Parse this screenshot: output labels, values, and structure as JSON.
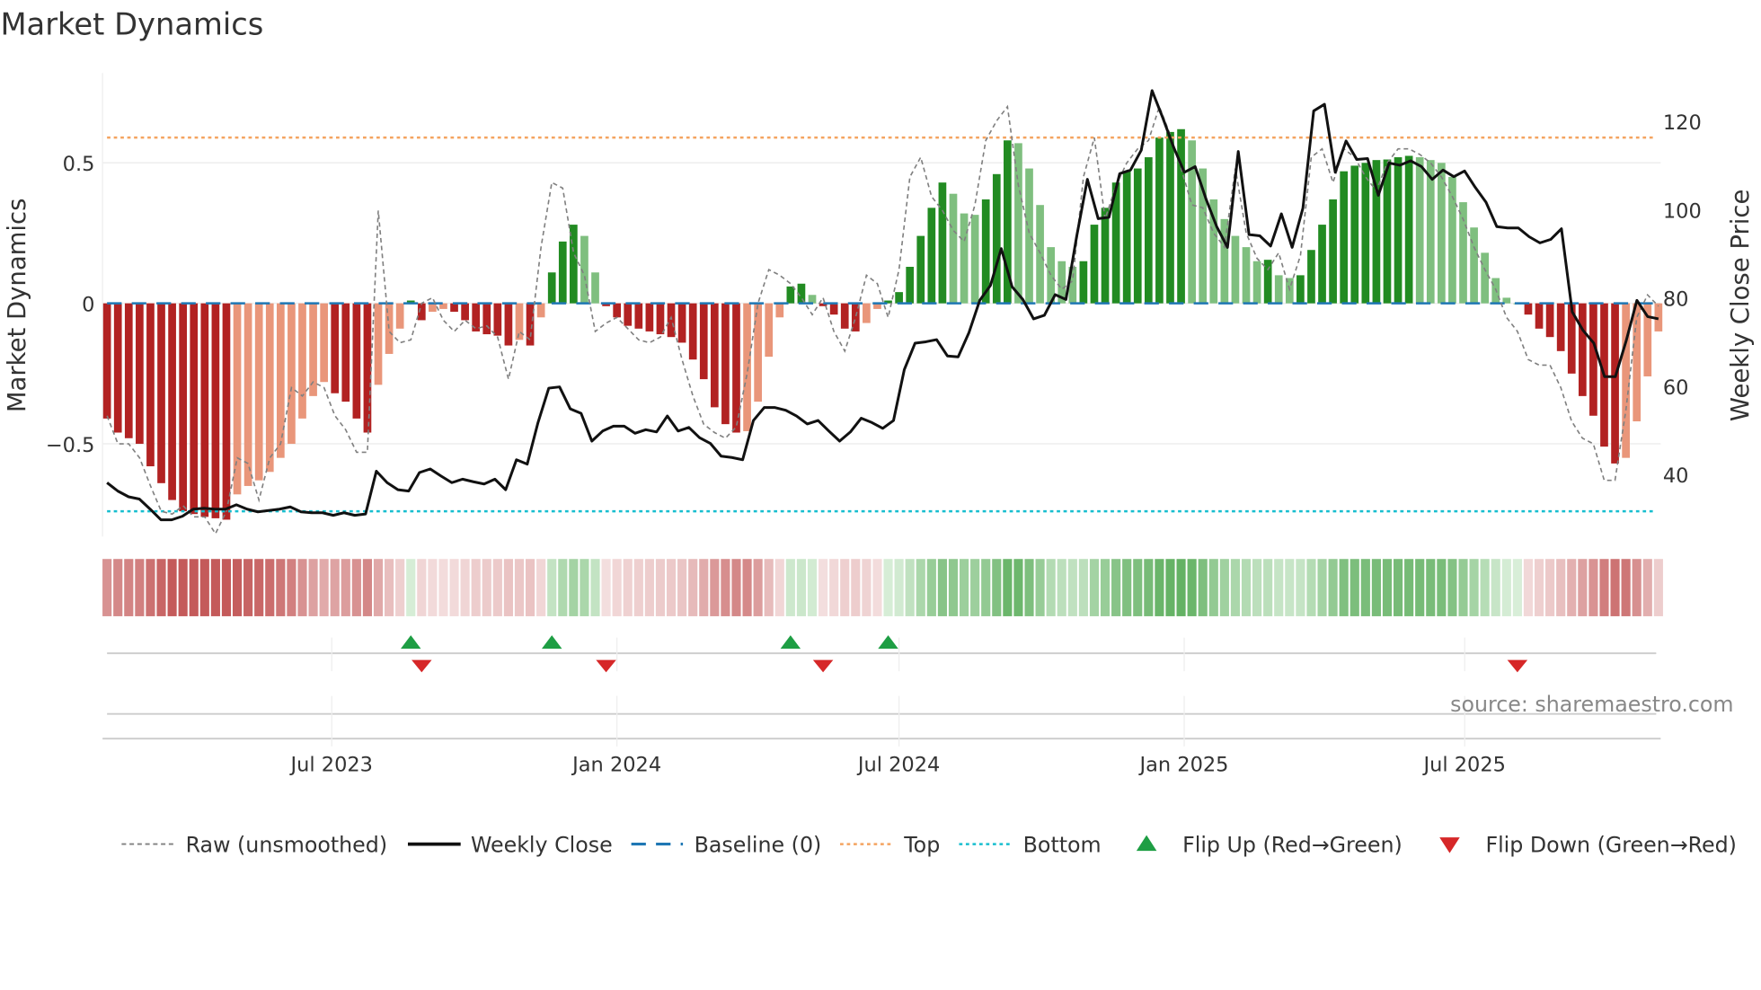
{
  "title": "Market Dynamics",
  "source": "source: sharemaestro.com",
  "colors": {
    "bar_neg_falling": "#b22222",
    "bar_neg_rising": "#e9967a",
    "bar_pos_rising": "#228b22",
    "bar_pos_falling": "#7fbf7f",
    "raw": "#808080",
    "close": "#111111",
    "baseline": "#1f77b4",
    "top": "#f4a460",
    "bottom": "#17becf",
    "flip_up": "#1e9e44",
    "flip_down": "#d62728"
  },
  "chart_data": {
    "type": "bar",
    "title": "Market Dynamics",
    "ylabel": "Market Dynamics",
    "ylabel_right": "Weekly Close Price",
    "start_date": "2023-02-06",
    "frequency": "weekly",
    "ylim": [
      -0.83,
      0.82
    ],
    "ylim_right": [
      26,
      131
    ],
    "yticks": [
      {
        "v": 0.5,
        "label": "0.5"
      },
      {
        "v": 0,
        "label": "0"
      },
      {
        "v": -0.5,
        "label": "−0.5"
      }
    ],
    "yticks_right": [
      {
        "v": 120,
        "label": "120"
      },
      {
        "v": 100,
        "label": "100"
      },
      {
        "v": 80,
        "label": "80"
      },
      {
        "v": 60,
        "label": "60"
      },
      {
        "v": 40,
        "label": "40"
      }
    ],
    "xticks": [
      {
        "date": "2023-07-01",
        "label": "Jul 2023"
      },
      {
        "date": "2024-01-01",
        "label": "Jan 2024"
      },
      {
        "date": "2024-07-01",
        "label": "Jul 2024"
      },
      {
        "date": "2025-01-01",
        "label": "Jan 2025"
      },
      {
        "date": "2025-07-01",
        "label": "Jul 2025"
      }
    ],
    "top_level": 0.59,
    "bottom_level": -0.74,
    "baseline": 0,
    "smoothed": [
      -0.41,
      -0.46,
      -0.48,
      -0.5,
      -0.58,
      -0.64,
      -0.7,
      -0.74,
      -0.75,
      -0.76,
      -0.765,
      -0.77,
      -0.68,
      -0.65,
      -0.63,
      -0.6,
      -0.55,
      -0.5,
      -0.41,
      -0.33,
      -0.28,
      -0.32,
      -0.35,
      -0.41,
      -0.46,
      -0.29,
      -0.18,
      -0.09,
      0.01,
      -0.06,
      -0.03,
      -0.02,
      -0.03,
      -0.06,
      -0.1,
      -0.11,
      -0.115,
      -0.15,
      -0.13,
      -0.15,
      -0.05,
      0.11,
      0.22,
      0.28,
      0.24,
      0.11,
      -0.01,
      -0.05,
      -0.08,
      -0.09,
      -0.1,
      -0.11,
      -0.12,
      -0.14,
      -0.2,
      -0.27,
      -0.37,
      -0.43,
      -0.46,
      -0.455,
      -0.35,
      -0.19,
      -0.05,
      0.06,
      0.07,
      0.03,
      -0.01,
      -0.04,
      -0.09,
      -0.1,
      -0.07,
      -0.02,
      0.01,
      0.04,
      0.13,
      0.24,
      0.34,
      0.43,
      0.39,
      0.32,
      0.315,
      0.37,
      0.46,
      0.58,
      0.57,
      0.48,
      0.35,
      0.2,
      0.15,
      0.13,
      0.15,
      0.28,
      0.34,
      0.43,
      0.47,
      0.48,
      0.52,
      0.59,
      0.61,
      0.62,
      0.58,
      0.48,
      0.37,
      0.3,
      0.24,
      0.2,
      0.15,
      0.155,
      0.1,
      0.09,
      0.1,
      0.19,
      0.28,
      0.37,
      0.47,
      0.49,
      0.5,
      0.51,
      0.512,
      0.52,
      0.525,
      0.52,
      0.51,
      0.5,
      0.45,
      0.36,
      0.27,
      0.18,
      0.09,
      0.02,
      0.0,
      -0.04,
      -0.09,
      -0.12,
      -0.17,
      -0.25,
      -0.33,
      -0.4,
      -0.51,
      -0.57,
      -0.55,
      -0.42,
      -0.26,
      -0.1
    ],
    "raw": [
      -0.4,
      -0.5,
      -0.5,
      -0.55,
      -0.65,
      -0.74,
      -0.75,
      -0.72,
      -0.76,
      -0.76,
      -0.82,
      -0.74,
      -0.55,
      -0.57,
      -0.7,
      -0.55,
      -0.5,
      -0.3,
      -0.33,
      -0.28,
      -0.3,
      -0.4,
      -0.45,
      -0.53,
      -0.53,
      0.33,
      -0.1,
      -0.14,
      -0.13,
      0.0,
      0.02,
      -0.06,
      -0.1,
      -0.06,
      -0.09,
      -0.08,
      -0.12,
      -0.27,
      -0.1,
      -0.13,
      0.2,
      0.43,
      0.41,
      0.18,
      0.1,
      -0.1,
      -0.07,
      -0.05,
      -0.09,
      -0.13,
      -0.14,
      -0.12,
      -0.05,
      -0.2,
      -0.33,
      -0.43,
      -0.46,
      -0.48,
      -0.44,
      -0.25,
      0.0,
      0.12,
      0.1,
      0.07,
      0.02,
      -0.04,
      0.02,
      -0.1,
      -0.17,
      -0.05,
      0.1,
      0.07,
      -0.05,
      0.12,
      0.45,
      0.52,
      0.38,
      0.33,
      0.26,
      0.22,
      0.35,
      0.58,
      0.65,
      0.7,
      0.42,
      0.25,
      0.18,
      0.1,
      0.05,
      0.08,
      0.45,
      0.59,
      0.3,
      0.42,
      0.5,
      0.55,
      0.58,
      0.7,
      0.6,
      0.48,
      0.35,
      0.34,
      0.25,
      0.2,
      0.48,
      0.25,
      0.16,
      0.12,
      0.18,
      0.05,
      0.17,
      0.52,
      0.55,
      0.43,
      0.55,
      0.52,
      0.45,
      0.4,
      0.5,
      0.55,
      0.55,
      0.53,
      0.5,
      0.45,
      0.38,
      0.3,
      0.2,
      0.12,
      0.05,
      -0.05,
      -0.1,
      -0.2,
      -0.22,
      -0.22,
      -0.3,
      -0.42,
      -0.48,
      -0.5,
      -0.63,
      -0.63,
      -0.38,
      -0.05,
      0.03,
      -0.01
    ],
    "close": [
      38.2,
      36.3,
      35,
      34.5,
      32.2,
      29.8,
      29.8,
      30.6,
      32.2,
      32.4,
      32.2,
      32.2,
      33.2,
      32.2,
      31.6,
      31.9,
      32.2,
      32.7,
      31.6,
      31.4,
      31.4,
      30.8,
      31.4,
      30.8,
      31.1,
      40.8,
      38.2,
      36.6,
      36.3,
      40.5,
      41.3,
      39.7,
      38.2,
      39,
      38.4,
      37.9,
      39,
      36.6,
      43.4,
      42.4,
      51.8,
      59.6,
      59.9,
      54.9,
      53.9,
      47.6,
      49.9,
      51,
      51,
      49.4,
      50.2,
      49.7,
      53.3,
      49.9,
      50.7,
      48.4,
      47.1,
      44.2,
      43.9,
      43.4,
      52.3,
      55.2,
      55.2,
      54.6,
      53.3,
      51.5,
      52.3,
      49.9,
      47.6,
      49.7,
      52.8,
      51.8,
      50.5,
      52.3,
      63.8,
      69.8,
      70.1,
      70.6,
      66.9,
      66.7,
      72.2,
      79.5,
      82.9,
      91.2,
      82.6,
      79.7,
      75.3,
      76.1,
      80.8,
      79.7,
      93.9,
      106.9,
      98,
      98.3,
      108.2,
      109,
      113.5,
      127,
      120.8,
      114.2,
      108.5,
      109.8,
      102.5,
      96.2,
      91.5,
      113.2,
      94.4,
      94.1,
      91.8,
      99.1,
      91.5,
      100.4,
      122.4,
      123.9,
      108.5,
      115.6,
      111.4,
      111.6,
      103.3,
      110.6,
      110.1,
      111.1,
      109.8,
      106.9,
      109,
      107.5,
      108.8,
      105.1,
      101.7,
      96.2,
      95.9,
      95.9,
      93.9,
      92.5,
      93.3,
      95.7,
      76.9,
      72.7,
      69.8,
      62.2,
      62.2,
      70.3,
      79.5,
      75.8,
      75.3
    ],
    "flip_up_dates": [
      "2023-08-21",
      "2023-11-20",
      "2024-04-22",
      "2024-06-24"
    ],
    "flip_down_dates": [
      "2023-08-28",
      "2023-12-25",
      "2024-05-13",
      "2025-08-04"
    ],
    "legend": {
      "placement": "bottom",
      "items": [
        "Raw (unsmoothed)",
        "Weekly Close",
        "Baseline (0)",
        "Top",
        "Bottom",
        "Flip Up (Red→Green)",
        "Flip Down (Green→Red)"
      ]
    }
  }
}
